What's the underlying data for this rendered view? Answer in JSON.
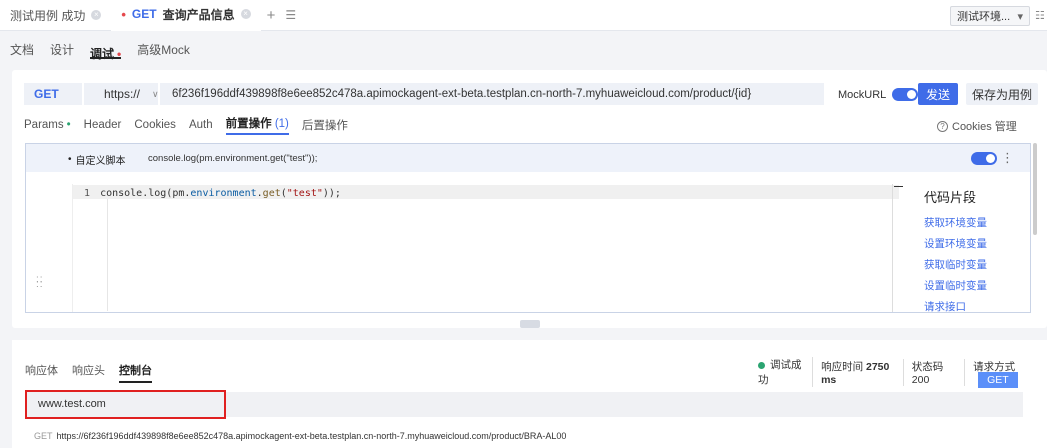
{
  "tabs": [
    {
      "label": "测试用例 成功",
      "active": false
    },
    {
      "label": "查询产品信息",
      "method": "GET",
      "active": true
    }
  ],
  "tab_bar": {
    "add": "+",
    "menu": "☰"
  },
  "environment": {
    "label": "测试环境...",
    "arrow": "▾",
    "extra": "☷"
  },
  "sub_tabs": [
    {
      "label": "文档"
    },
    {
      "label": "设计"
    },
    {
      "label": "调试",
      "active": true
    },
    {
      "label": "高级Mock"
    }
  ],
  "request": {
    "method": "GET",
    "protocol": "https://",
    "url": "6f236f196ddf439898f8e6ee852c478a.apimockagent-ext-beta.testplan.cn-north-7.myhuaweicloud.com/product/{id}",
    "mock_url_label": "MockURL",
    "mock_url_enabled": true,
    "send_label": "发送",
    "save_label": "保存为用例"
  },
  "request_tabs": [
    {
      "label": "Params",
      "dot": true
    },
    {
      "label": "Header"
    },
    {
      "label": "Cookies"
    },
    {
      "label": "Auth"
    },
    {
      "label": "前置操作",
      "count": "(1)",
      "active": true
    },
    {
      "label": "后置操作"
    }
  ],
  "cookies_manage": {
    "label": "Cookies 管理",
    "icon": "?"
  },
  "script": {
    "title": "自定义脚本",
    "preview": "console.log(pm.environment.get(\"test\"));",
    "enabled": true,
    "line_number": "1",
    "code": {
      "p1": "console",
      "p2": ".log(",
      "p3": "pm",
      "p4": ".",
      "p5": "environment",
      "p6": ".",
      "p7": "get",
      "p8": "(",
      "p9": "\"test\"",
      "p10": "));"
    }
  },
  "snippets": {
    "title": "代码片段",
    "items": [
      "获取环境变量",
      "设置环境变量",
      "获取临时变量",
      "设置临时变量",
      "请求接口"
    ]
  },
  "response": {
    "tabs": [
      {
        "label": "响应体"
      },
      {
        "label": "响应头"
      },
      {
        "label": "控制台",
        "active": true
      }
    ],
    "status_text": "调试成功",
    "response_time_label": "响应时间",
    "response_time_value": "2750 ms",
    "status_code_label": "状态码",
    "status_code_value": "200",
    "method_label": "请求方式",
    "method_value": "GET",
    "console_output": "www.test.com",
    "log_method": "GET",
    "log_url": "https://6f236f196ddf439898f8e6ee852c478a.apimockagent-ext-beta.testplan.cn-north-7.myhuaweicloud.com/product/BRA-AL00"
  },
  "colors": {
    "accent": "#3f6ce8",
    "success": "#2ba471",
    "alert_dot": "#e5484d",
    "highlight_box": "#e02020"
  }
}
